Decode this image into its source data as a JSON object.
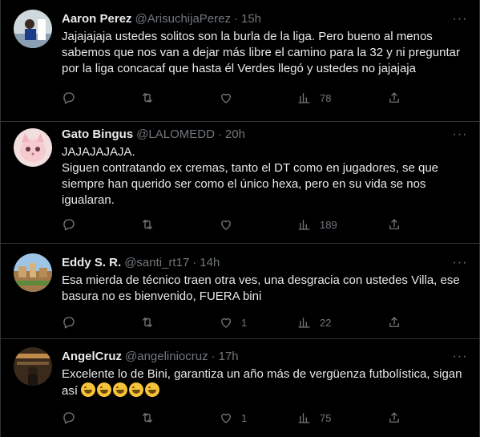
{
  "tweets": [
    {
      "name": "Aaron Perez",
      "handle": "@ArisuchijaPerez",
      "time": "15h",
      "text": "Jajajajaja ustedes solitos son la burla de la liga. Pero bueno al menos sabemos que nos van a dejar más libre el camino para la 32 y ni preguntar por la liga concacaf que hasta él Verdes llegó y ustedes no jajajaja",
      "retweets": "",
      "likes": "",
      "views": "78"
    },
    {
      "name": "Gato Bingus",
      "handle": "@LALOMEDD",
      "time": "20h",
      "text": "JAJAJAJAJA.\nSiguen contratando ex cremas, tanto el DT como en jugadores, se que siempre han querido ser como el único hexa, pero en su vida se nos igualaran.",
      "retweets": "",
      "likes": "",
      "views": "189"
    },
    {
      "name": "Eddy S. R.",
      "handle": "@santi_rt17",
      "time": "14h",
      "text": "Esa mierda de técnico traen otra ves, una desgracia con ustedes Villa, ese basura no es bienvenido, FUERA bini",
      "retweets": "",
      "likes": "1",
      "views": "22"
    },
    {
      "name": "AngelCruz",
      "handle": "@angeliniocruz",
      "time": "17h",
      "text": "Excelente lo de Bini, garantiza un año más de vergüenza futbolística, sigan así",
      "retweets": "",
      "likes": "1",
      "views": "75"
    }
  ],
  "separator": "·",
  "more_glyph": "···",
  "colors": {
    "background": "#000000",
    "text": "#e7e9ea",
    "muted": "#71767b",
    "border": "#2f3336"
  },
  "icons": [
    "reply-icon",
    "retweet-icon",
    "like-icon",
    "views-icon",
    "share-icon",
    "more-icon",
    "laughing-emoji"
  ]
}
